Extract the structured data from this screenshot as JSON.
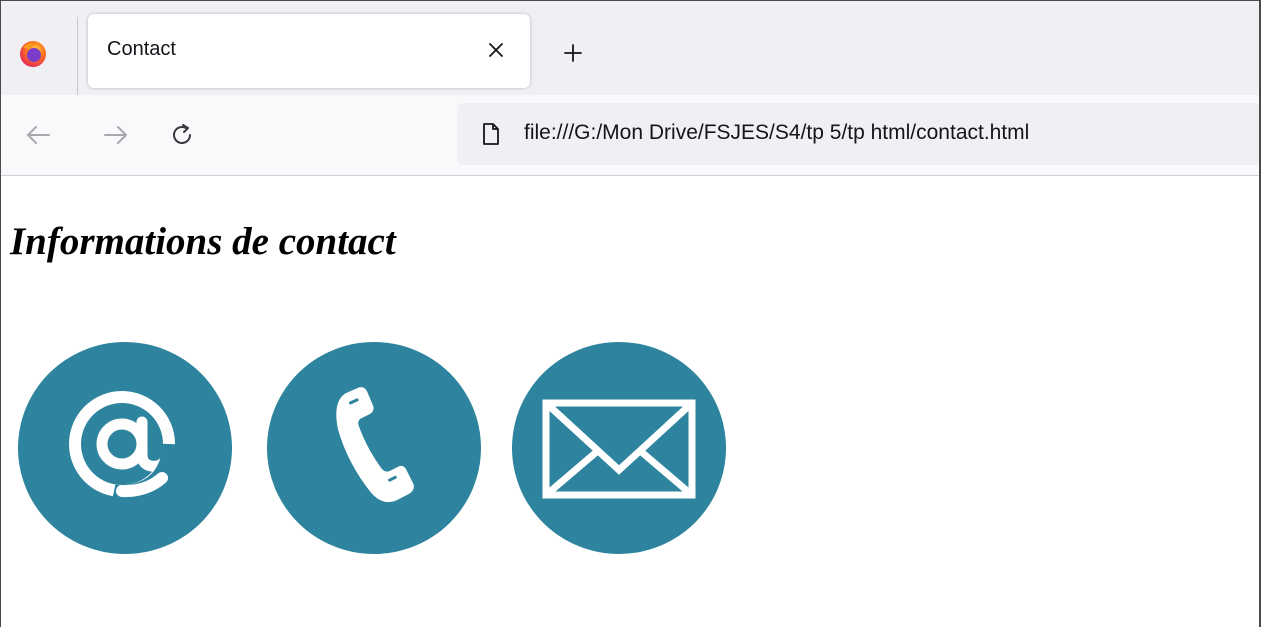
{
  "browser": {
    "tab": {
      "title": "Contact"
    },
    "address_bar": {
      "url": "file:///G:/Mon Drive/FSJES/S4/tp 5/tp html/contact.html"
    }
  },
  "page": {
    "heading": "Informations de contact",
    "icons": [
      "at-sign-icon",
      "phone-icon",
      "envelope-icon"
    ],
    "icon_color": "#2e849e"
  },
  "colors": {
    "tabstrip_bg": "#f0f0f4",
    "navbar_bg": "#f9f9fb",
    "urlbar_bg": "#f0f0f4",
    "text": "#15141a",
    "icon_bg": "#2e849e"
  }
}
